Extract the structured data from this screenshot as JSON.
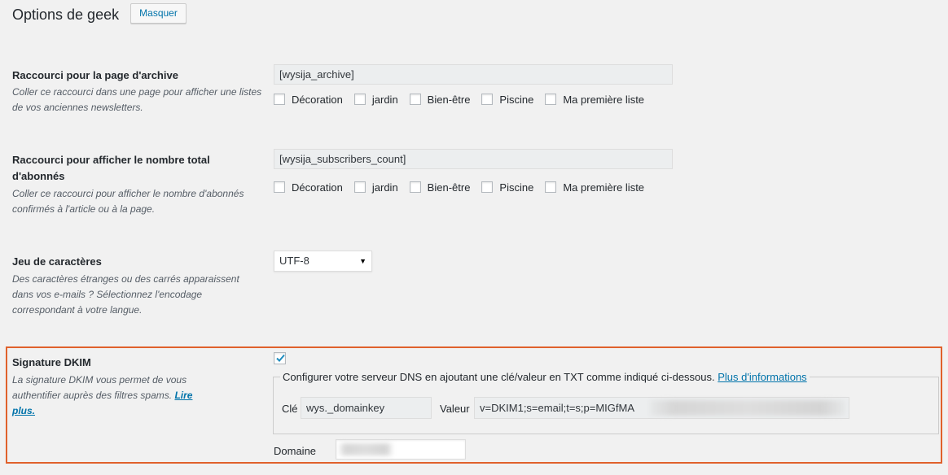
{
  "header": {
    "title": "Options de geek",
    "hide_button": "Masquer"
  },
  "archive_section": {
    "label": "Raccourci pour la page d'archive",
    "description": "Coller ce raccourci dans une page pour afficher une listes de vos anciennes newsletters.",
    "shortcode": "[wysija_archive]",
    "lists": [
      {
        "label": "Décoration",
        "checked": false
      },
      {
        "label": "jardin",
        "checked": false
      },
      {
        "label": "Bien-être",
        "checked": false
      },
      {
        "label": "Piscine",
        "checked": false
      },
      {
        "label": "Ma première liste",
        "checked": false
      }
    ]
  },
  "subscribers_section": {
    "label": "Raccourci pour afficher le nombre total d'abonnés",
    "description": "Coller ce raccourci pour afficher le nombre d'abonnés confirmés à l'article ou à la page.",
    "shortcode": "[wysija_subscribers_count]",
    "lists": [
      {
        "label": "Décoration",
        "checked": false
      },
      {
        "label": "jardin",
        "checked": false
      },
      {
        "label": "Bien-être",
        "checked": false
      },
      {
        "label": "Piscine",
        "checked": false
      },
      {
        "label": "Ma première liste",
        "checked": false
      }
    ]
  },
  "charset_section": {
    "label": "Jeu de caractères",
    "description": "Des caractères étranges ou des carrés apparaissent dans vos e-mails ? Sélectionnez l'encodage correspondant à votre langue.",
    "selected": "UTF-8"
  },
  "dkim_section": {
    "label": "Signature DKIM",
    "description": "La signature DKIM vous permet de vous authentifier auprès des filtres spams.",
    "read_more": "Lire plus.",
    "enabled": true,
    "dns_instructions": "Configurer votre serveur DNS en ajoutant une clé/valeur en TXT comme indiqué ci-dessous.",
    "more_info_link": "Plus d'informations",
    "key_label": "Clé",
    "key_value": "wys._domainkey",
    "value_label": "Valeur",
    "value_text": "v=DKIM1;s=email;t=s;p=MIGfMA",
    "domain_label": "Domaine",
    "highlight_color": "#e0612c"
  }
}
